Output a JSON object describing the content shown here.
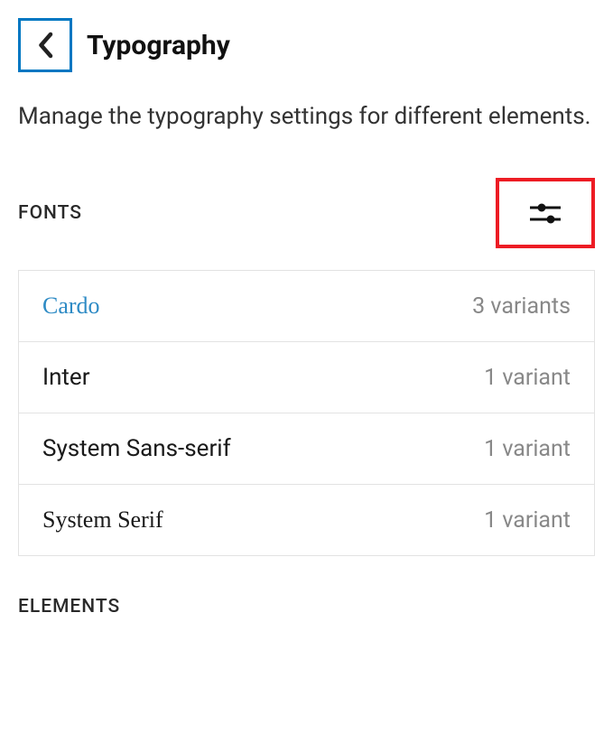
{
  "header": {
    "title": "Typography"
  },
  "description": "Manage the typography settings for different elements.",
  "sections": {
    "fonts": {
      "label": "FONTS",
      "items": [
        {
          "name": "Cardo",
          "variants": "3 variants"
        },
        {
          "name": "Inter",
          "variants": "1 variant"
        },
        {
          "name": "System Sans-serif",
          "variants": "1 variant"
        },
        {
          "name": "System Serif",
          "variants": "1 variant"
        }
      ]
    },
    "elements": {
      "label": "ELEMENTS"
    }
  }
}
